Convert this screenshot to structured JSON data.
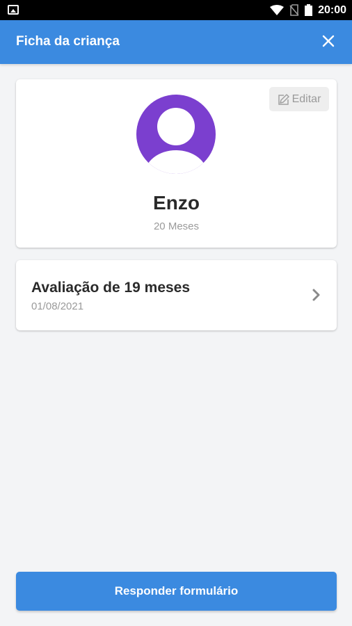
{
  "status_bar": {
    "time": "20:00",
    "icons": [
      "gallery-icon",
      "wifi-icon",
      "no-sim-icon",
      "battery-icon"
    ]
  },
  "header": {
    "title": "Ficha da criança",
    "close_icon": "close-icon"
  },
  "profile": {
    "edit_label": "Editar",
    "edit_icon": "edit-icon",
    "avatar_icon": "user-avatar-icon",
    "name": "Enzo",
    "age": "20 Meses"
  },
  "evaluations": [
    {
      "title": "Avaliação de 19 meses",
      "date": "01/08/2021"
    }
  ],
  "footer": {
    "primary_button": "Responder formulário"
  },
  "colors": {
    "primary": "#3b8ae0",
    "avatar": "#7b3fcf",
    "background": "#f3f4f6",
    "text_dark": "#2a2a2a",
    "text_muted": "#9a9a9a"
  }
}
